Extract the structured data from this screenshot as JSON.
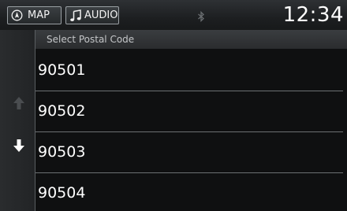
{
  "topbar": {
    "map_label": "MAP",
    "audio_label": "AUDIO",
    "clock": "12:34"
  },
  "list": {
    "title": "Select Postal Code",
    "items": [
      {
        "label": "90501"
      },
      {
        "label": "90502"
      },
      {
        "label": "90503"
      },
      {
        "label": "90504"
      }
    ]
  },
  "colors": {
    "background": "#0f1011",
    "text": "#ffffff",
    "separator": "#6c7073",
    "scroll_up_disabled": "#4a4d50",
    "scroll_down_active": "#ffffff"
  },
  "icons": {
    "map": "navigation-compass-icon",
    "audio": "music-note-icon",
    "status": "bluetooth-icon",
    "scroll_up": "arrow-up-icon",
    "scroll_down": "arrow-down-icon"
  }
}
